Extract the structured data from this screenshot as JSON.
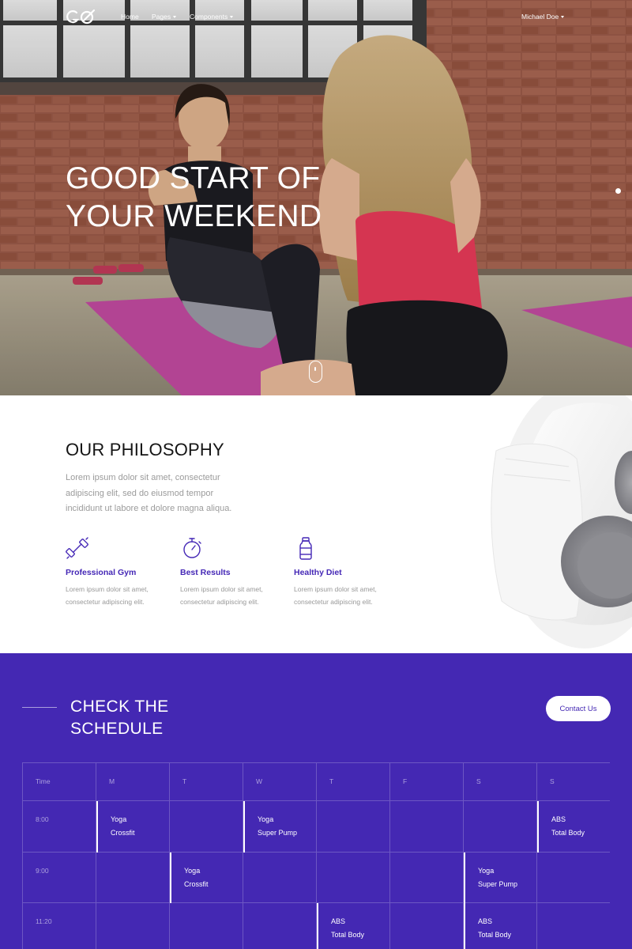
{
  "navbar": {
    "logo_text": "GO",
    "links": [
      {
        "label": "Home",
        "has_dropdown": false
      },
      {
        "label": "Pages",
        "has_dropdown": true
      },
      {
        "label": "Components",
        "has_dropdown": true
      }
    ],
    "user_label": "Michael Doe"
  },
  "hero": {
    "title_line1": "Good start of",
    "title_line2": "your weekend"
  },
  "philosophy": {
    "title": "Our Philosophy",
    "text": "Lorem ipsum dolor sit amet, consectetur adipiscing elit, sed do eiusmod tempor incididunt ut labore et dolore magna aliqua.",
    "features": [
      {
        "icon": "dumbbell-icon",
        "title": "Professional Gym",
        "text": "Lorem ipsum dolor sit amet, consectetur adipiscing elit."
      },
      {
        "icon": "stopwatch-icon",
        "title": "Best Results",
        "text": "Lorem ipsum dolor sit amet, consectetur adipiscing elit."
      },
      {
        "icon": "water-bottle-icon",
        "title": "Healthy Diet",
        "text": "Lorem ipsum dolor sit amet, consectetur adipiscing elit."
      }
    ]
  },
  "schedule": {
    "title": "Check the schedule",
    "contact_label": "Contact Us",
    "headers": [
      "Time",
      "M",
      "T",
      "W",
      "T",
      "F",
      "S",
      "S"
    ],
    "rows": [
      {
        "time": "8:00",
        "classes": [
          [
            "Yoga",
            "Crossfit"
          ],
          null,
          [
            "Yoga",
            "Super Pump"
          ],
          null,
          null,
          null,
          [
            "ABS",
            "Total Body"
          ]
        ]
      },
      {
        "time": "9:00",
        "classes": [
          null,
          [
            "Yoga",
            "Crossfit"
          ],
          null,
          null,
          null,
          [
            "Yoga",
            "Super Pump"
          ],
          null
        ]
      },
      {
        "time": "11:20",
        "classes": [
          null,
          null,
          null,
          [
            "ABS",
            "Total Body"
          ],
          null,
          [
            "ABS",
            "Total Body"
          ],
          null
        ]
      }
    ]
  },
  "colors": {
    "accent": "#4428b3",
    "feature_title": "#4528b6",
    "hero_mat": "#c24aa0"
  }
}
